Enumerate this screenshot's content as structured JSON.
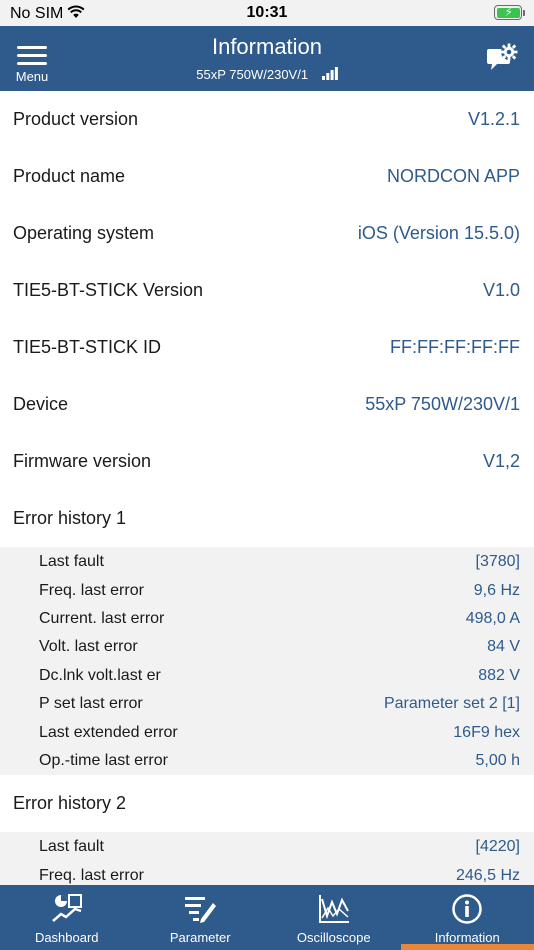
{
  "status": {
    "carrier": "No SIM",
    "time": "10:31"
  },
  "header": {
    "menu_label": "Menu",
    "title": "Information",
    "subtitle": "55xP 750W/230V/1"
  },
  "info_rows": [
    {
      "label": "Product version",
      "value": "V1.2.1"
    },
    {
      "label": "Product name",
      "value": "NORDCON APP"
    },
    {
      "label": "Operating system",
      "value": "iOS (Version 15.5.0)"
    },
    {
      "label": "TIE5-BT-STICK Version",
      "value": "V1.0"
    },
    {
      "label": "TIE5-BT-STICK ID",
      "value": "FF:FF:FF:FF:FF"
    },
    {
      "label": "Device",
      "value": "55xP 750W/230V/1"
    },
    {
      "label": "Firmware version",
      "value": "V1,2"
    }
  ],
  "error_history_1": {
    "title": "Error history 1",
    "rows": [
      {
        "label": "Last fault",
        "value": "[3780]"
      },
      {
        "label": "Freq. last error",
        "value": "9,6 Hz"
      },
      {
        "label": "Current. last error",
        "value": "498,0 A"
      },
      {
        "label": "Volt. last error",
        "value": "84 V"
      },
      {
        "label": "Dc.lnk volt.last er",
        "value": "882 V"
      },
      {
        "label": "P set last error",
        "value": "Parameter set 2 [1]"
      },
      {
        "label": "Last extended error",
        "value": "16F9 hex"
      },
      {
        "label": "Op.-time last error",
        "value": "5,00 h"
      }
    ]
  },
  "error_history_2": {
    "title": "Error history 2",
    "rows": [
      {
        "label": "Last fault",
        "value": "[4220]"
      },
      {
        "label": "Freq. last error",
        "value": "246,5 Hz"
      }
    ]
  },
  "tabs": [
    {
      "label": "Dashboard",
      "icon": "dashboard-icon"
    },
    {
      "label": "Parameter",
      "icon": "parameter-icon"
    },
    {
      "label": "Oscilloscope",
      "icon": "oscilloscope-icon"
    },
    {
      "label": "Information",
      "icon": "information-icon",
      "active": true
    }
  ],
  "colors": {
    "brand": "#2e5a8c",
    "accent": "#e8873a",
    "battery": "#3cc24e"
  }
}
